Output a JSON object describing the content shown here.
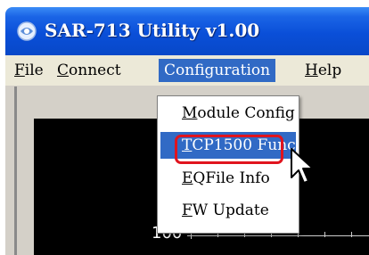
{
  "window": {
    "title": "SAR-713 Utility v1.00"
  },
  "menubar": {
    "items": [
      {
        "id": "file",
        "underline": "F",
        "rest": "ile"
      },
      {
        "id": "connect",
        "underline": "C",
        "rest": "onnect"
      },
      {
        "id": "configuration",
        "label": "Configuration"
      },
      {
        "id": "help",
        "underline": "H",
        "rest": "elp"
      }
    ]
  },
  "configuration_menu": {
    "items": [
      {
        "underline": "M",
        "rest": "odule Config"
      },
      {
        "underline": "T",
        "rest": "CP1500 Func"
      },
      {
        "underline": "E",
        "rest": "QFile Info"
      },
      {
        "underline": "F",
        "rest": "W Update"
      }
    ],
    "highlighted_item": "TCP1500 Func"
  },
  "plot": {
    "y_label": "100"
  },
  "colors": {
    "highlight": "#316ac5",
    "annotation": "#e0141e",
    "titlebar": "#0a4fd8"
  },
  "icons": [
    "app-icon",
    "mouse-pointer-icon"
  ]
}
